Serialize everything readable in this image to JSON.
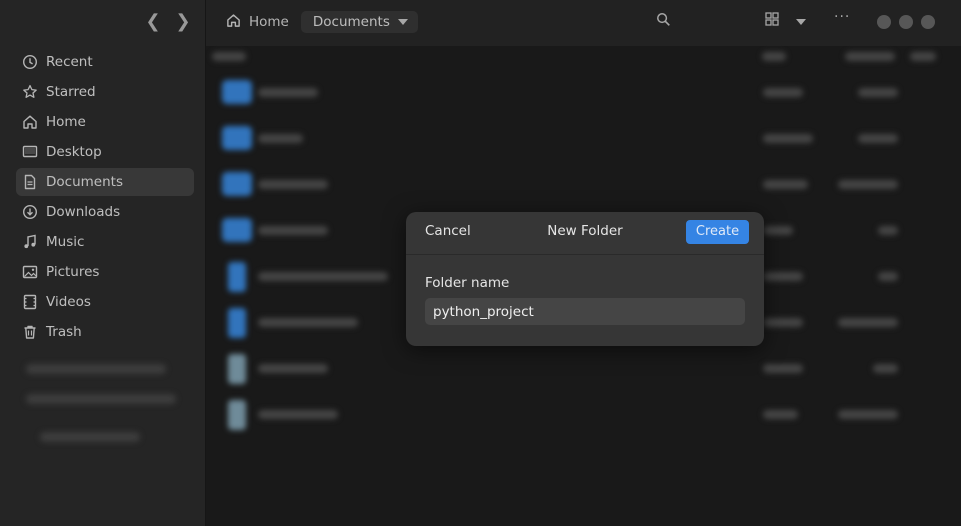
{
  "breadcrumb": {
    "home": "Home",
    "current": "Documents"
  },
  "sidebar": {
    "items": [
      {
        "label": "Recent",
        "icon": "clock-icon"
      },
      {
        "label": "Starred",
        "icon": "star-icon"
      },
      {
        "label": "Home",
        "icon": "home-icon"
      },
      {
        "label": "Desktop",
        "icon": "desktop-icon"
      },
      {
        "label": "Documents",
        "icon": "documents-icon",
        "active": true
      },
      {
        "label": "Downloads",
        "icon": "download-icon"
      },
      {
        "label": "Music",
        "icon": "music-icon"
      },
      {
        "label": "Pictures",
        "icon": "pictures-icon"
      },
      {
        "label": "Videos",
        "icon": "videos-icon"
      },
      {
        "label": "Trash",
        "icon": "trash-icon"
      }
    ]
  },
  "dialog": {
    "title": "New Folder",
    "cancel_label": "Cancel",
    "create_label": "Create",
    "field_label": "Folder name",
    "field_value": "python_project"
  },
  "colors": {
    "accent": "#3584e4",
    "folder": "#3d8ee6"
  }
}
